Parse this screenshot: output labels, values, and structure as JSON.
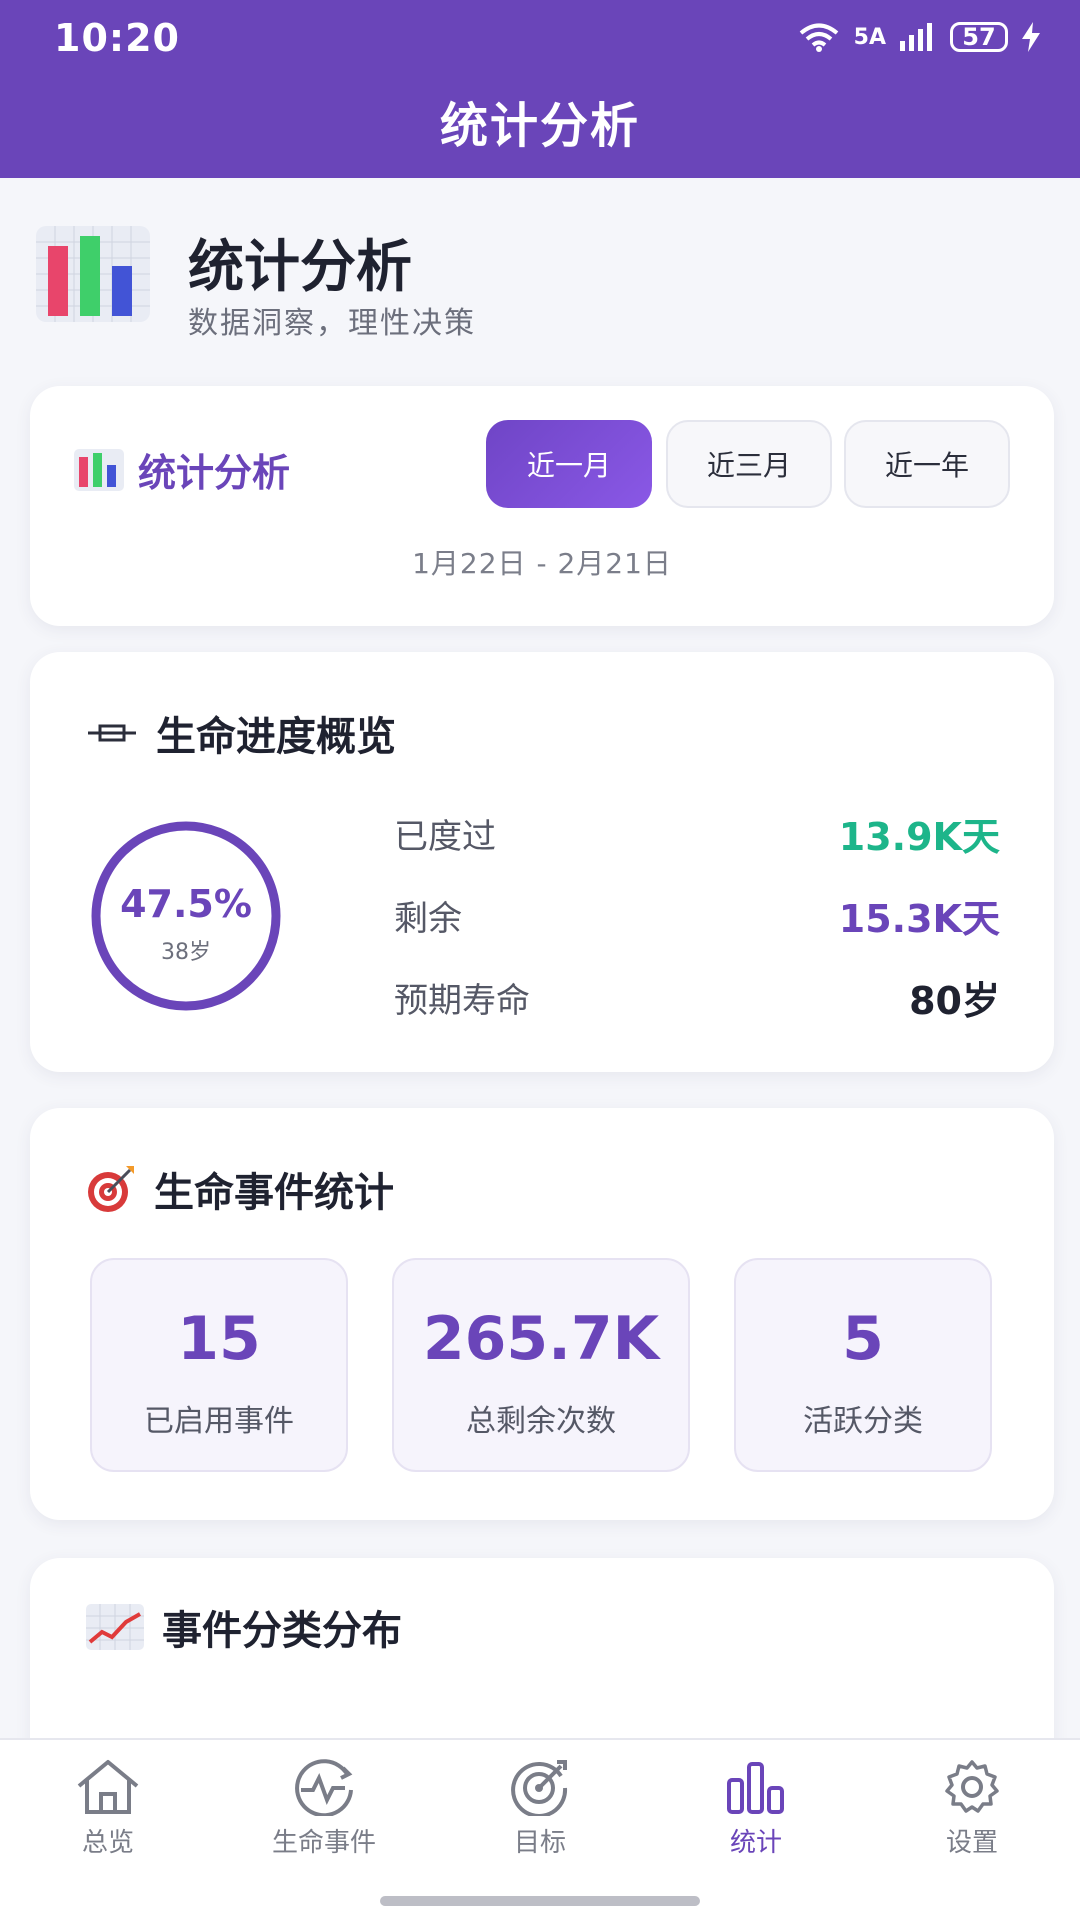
{
  "status_bar": {
    "time": "10:20",
    "network": "5A",
    "battery": "57"
  },
  "app_bar": {
    "title": "统计分析"
  },
  "header": {
    "icon": "bar-chart-icon",
    "title": "统计分析",
    "subtitle": "数据洞察，理性决策"
  },
  "period_card": {
    "title": "统计分析",
    "icon": "bar-chart-icon",
    "options": [
      "近一月",
      "近三月",
      "近一年"
    ],
    "selected": "近一月",
    "date_range": "1月22日 - 2月21日"
  },
  "life_progress": {
    "title": "生命进度概览",
    "icon": "hourglass-icon",
    "percent": "47.5%",
    "percent_value": 47.5,
    "age": "38岁",
    "rows": [
      {
        "label": "已度过",
        "value": "13.9K天"
      },
      {
        "label": "剩余",
        "value": "15.3K天"
      },
      {
        "label": "预期寿命",
        "value": "80岁"
      }
    ],
    "colors": {
      "passed": "#1db58a",
      "remaining": "#6a45b9"
    }
  },
  "event_stats": {
    "title": "生命事件统计",
    "icon": "target-icon",
    "tiles": [
      {
        "value": "15",
        "label": "已启用事件"
      },
      {
        "value": "265.7K",
        "label": "总剩余次数"
      },
      {
        "value": "5",
        "label": "活跃分类"
      }
    ]
  },
  "category_dist": {
    "title": "事件分类分布",
    "icon": "trend-chart-icon"
  },
  "tab_bar": {
    "items": [
      {
        "label": "总览",
        "icon": "home-icon"
      },
      {
        "label": "生命事件",
        "icon": "heartbeat-icon"
      },
      {
        "label": "目标",
        "icon": "target-icon"
      },
      {
        "label": "统计",
        "icon": "bar-chart-icon"
      },
      {
        "label": "设置",
        "icon": "gear-icon"
      }
    ],
    "active": "统计"
  },
  "theme": {
    "primary": "#6a45b9",
    "background": "#f5f6fa"
  }
}
